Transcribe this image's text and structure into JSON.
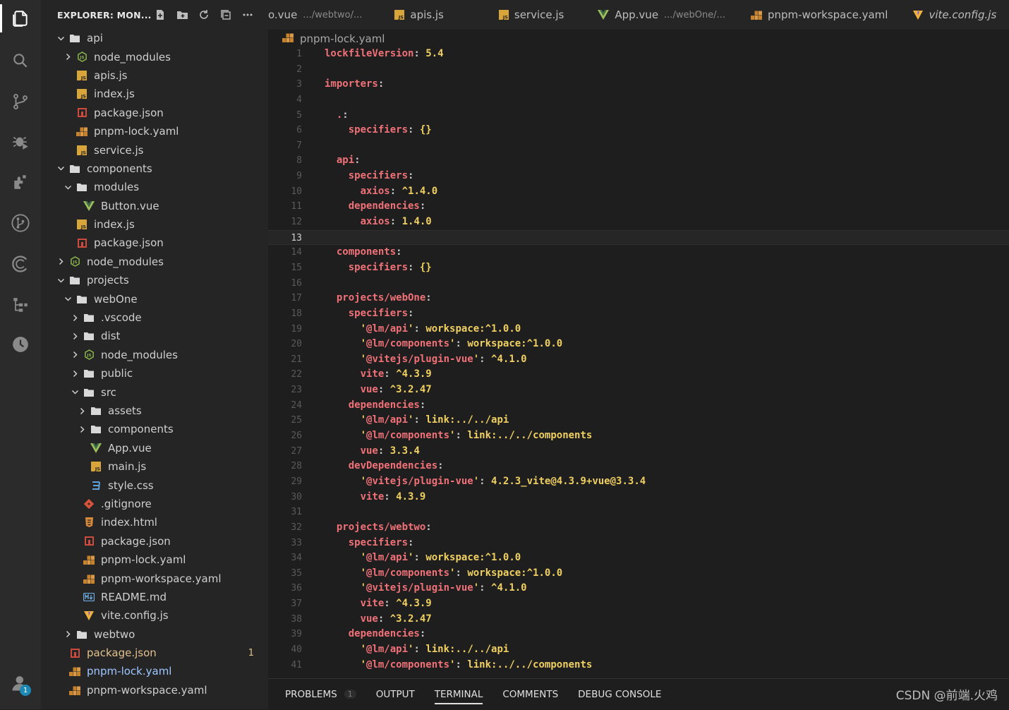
{
  "activity": {
    "items": [
      "files-icon",
      "search-icon",
      "source-control-icon",
      "debug-icon",
      "extensions-icon",
      "git-graph-icon",
      "copilot-icon",
      "timeline-icon",
      "clock-icon"
    ],
    "account_badge": "1"
  },
  "explorer": {
    "title": "EXPLORER: MON...",
    "rows": [
      {
        "depth": 0,
        "chev": "open",
        "icon": "folder",
        "label": "api"
      },
      {
        "depth": 1,
        "chev": "closed",
        "icon": "node",
        "label": "node_modules"
      },
      {
        "depth": 1,
        "chev": "none",
        "icon": "js",
        "label": "apis.js"
      },
      {
        "depth": 1,
        "chev": "none",
        "icon": "js",
        "label": "index.js"
      },
      {
        "depth": 1,
        "chev": "none",
        "icon": "pkg",
        "label": "package.json"
      },
      {
        "depth": 1,
        "chev": "none",
        "icon": "yaml",
        "label": "pnpm-lock.yaml"
      },
      {
        "depth": 1,
        "chev": "none",
        "icon": "js",
        "label": "service.js"
      },
      {
        "depth": 0,
        "chev": "open",
        "icon": "folder",
        "label": "components"
      },
      {
        "depth": 1,
        "chev": "open",
        "icon": "folder",
        "label": "modules"
      },
      {
        "depth": 2,
        "chev": "none",
        "icon": "vue",
        "label": "Button.vue"
      },
      {
        "depth": 1,
        "chev": "none",
        "icon": "js",
        "label": "index.js"
      },
      {
        "depth": 1,
        "chev": "none",
        "icon": "pkg",
        "label": "package.json"
      },
      {
        "depth": 0,
        "chev": "closed",
        "icon": "node",
        "label": "node_modules"
      },
      {
        "depth": 0,
        "chev": "open",
        "icon": "folder",
        "label": "projects"
      },
      {
        "depth": 1,
        "chev": "open",
        "icon": "folder",
        "label": "webOne"
      },
      {
        "depth": 2,
        "chev": "closed",
        "icon": "folder",
        "label": ".vscode"
      },
      {
        "depth": 2,
        "chev": "closed",
        "icon": "folder",
        "label": "dist"
      },
      {
        "depth": 2,
        "chev": "closed",
        "icon": "node",
        "label": "node_modules"
      },
      {
        "depth": 2,
        "chev": "closed",
        "icon": "folder",
        "label": "public"
      },
      {
        "depth": 2,
        "chev": "open",
        "icon": "folder",
        "label": "src"
      },
      {
        "depth": 3,
        "chev": "closed",
        "icon": "folder",
        "label": "assets"
      },
      {
        "depth": 3,
        "chev": "closed",
        "icon": "folder",
        "label": "components"
      },
      {
        "depth": 3,
        "chev": "none",
        "icon": "vue",
        "label": "App.vue"
      },
      {
        "depth": 3,
        "chev": "none",
        "icon": "js",
        "label": "main.js"
      },
      {
        "depth": 3,
        "chev": "none",
        "icon": "css",
        "label": "style.css"
      },
      {
        "depth": 2,
        "chev": "none",
        "icon": "git",
        "label": ".gitignore"
      },
      {
        "depth": 2,
        "chev": "none",
        "icon": "html",
        "label": "index.html"
      },
      {
        "depth": 2,
        "chev": "none",
        "icon": "pkg",
        "label": "package.json"
      },
      {
        "depth": 2,
        "chev": "none",
        "icon": "yaml",
        "label": "pnpm-lock.yaml"
      },
      {
        "depth": 2,
        "chev": "none",
        "icon": "yaml",
        "label": "pnpm-workspace.yaml"
      },
      {
        "depth": 2,
        "chev": "none",
        "icon": "md",
        "label": "README.md"
      },
      {
        "depth": 2,
        "chev": "none",
        "icon": "vite",
        "label": "vite.config.js"
      },
      {
        "depth": 1,
        "chev": "closed",
        "icon": "folder",
        "label": "webtwo"
      },
      {
        "depth": 0,
        "chev": "none",
        "icon": "pkg",
        "label": "package.json",
        "state": "modified",
        "count": "1"
      },
      {
        "depth": 0,
        "chev": "none",
        "icon": "yaml",
        "label": "pnpm-lock.yaml",
        "state": "active"
      },
      {
        "depth": 0,
        "chev": "none",
        "icon": "yaml",
        "label": "pnpm-workspace.yaml"
      }
    ]
  },
  "tabs": [
    {
      "name": "o.vue",
      "path": ".../webtwo/...",
      "icon": "none",
      "italic": false
    },
    {
      "name": "apis.js",
      "path": "",
      "icon": "js",
      "italic": false
    },
    {
      "name": "service.js",
      "path": "",
      "icon": "js",
      "italic": false
    },
    {
      "name": "App.vue",
      "path": ".../webOne/...",
      "icon": "vue",
      "italic": false
    },
    {
      "name": "pnpm-workspace.yaml",
      "path": "",
      "icon": "yaml",
      "italic": false
    },
    {
      "name": "vite.config.js",
      "path": "",
      "icon": "vite",
      "italic": true
    }
  ],
  "breadcrumb": "pnpm-lock.yaml",
  "editor": {
    "current_line": 13,
    "lines": [
      [
        [
          "k",
          "lockfileVersion"
        ],
        [
          "p",
          ": "
        ],
        [
          "v",
          "5.4"
        ]
      ],
      [],
      [
        [
          "k",
          "importers"
        ],
        [
          "p",
          ":"
        ]
      ],
      [],
      [
        [
          "p",
          "  "
        ],
        [
          "k",
          "."
        ],
        [
          "p",
          ":"
        ]
      ],
      [
        [
          "p",
          "    "
        ],
        [
          "k",
          "specifiers"
        ],
        [
          "p",
          ": "
        ],
        [
          "v",
          "{}"
        ]
      ],
      [],
      [
        [
          "p",
          "  "
        ],
        [
          "k",
          "api"
        ],
        [
          "p",
          ":"
        ]
      ],
      [
        [
          "p",
          "    "
        ],
        [
          "k",
          "specifiers"
        ],
        [
          "p",
          ":"
        ]
      ],
      [
        [
          "p",
          "      "
        ],
        [
          "k",
          "axios"
        ],
        [
          "p",
          ": "
        ],
        [
          "v",
          "^1.4.0"
        ]
      ],
      [
        [
          "p",
          "    "
        ],
        [
          "k",
          "dependencies"
        ],
        [
          "p",
          ":"
        ]
      ],
      [
        [
          "p",
          "      "
        ],
        [
          "k",
          "axios"
        ],
        [
          "p",
          ": "
        ],
        [
          "v",
          "1.4.0"
        ]
      ],
      [],
      [
        [
          "p",
          "  "
        ],
        [
          "k",
          "components"
        ],
        [
          "p",
          ":"
        ]
      ],
      [
        [
          "p",
          "    "
        ],
        [
          "k",
          "specifiers"
        ],
        [
          "p",
          ": "
        ],
        [
          "v",
          "{}"
        ]
      ],
      [],
      [
        [
          "p",
          "  "
        ],
        [
          "k",
          "projects/webOne"
        ],
        [
          "p",
          ":"
        ]
      ],
      [
        [
          "p",
          "    "
        ],
        [
          "k",
          "specifiers"
        ],
        [
          "p",
          ":"
        ]
      ],
      [
        [
          "p",
          "      "
        ],
        [
          "s",
          "'"
        ],
        [
          "k",
          "@lm/api"
        ],
        [
          "s",
          "'"
        ],
        [
          "p",
          ": "
        ],
        [
          "v",
          "workspace:^1.0.0"
        ]
      ],
      [
        [
          "p",
          "      "
        ],
        [
          "s",
          "'"
        ],
        [
          "k",
          "@lm/components"
        ],
        [
          "s",
          "'"
        ],
        [
          "p",
          ": "
        ],
        [
          "v",
          "workspace:^1.0.0"
        ]
      ],
      [
        [
          "p",
          "      "
        ],
        [
          "s",
          "'"
        ],
        [
          "k",
          "@vitejs/plugin-vue"
        ],
        [
          "s",
          "'"
        ],
        [
          "p",
          ": "
        ],
        [
          "v",
          "^4.1.0"
        ]
      ],
      [
        [
          "p",
          "      "
        ],
        [
          "k",
          "vite"
        ],
        [
          "p",
          ": "
        ],
        [
          "v",
          "^4.3.9"
        ]
      ],
      [
        [
          "p",
          "      "
        ],
        [
          "k",
          "vue"
        ],
        [
          "p",
          ": "
        ],
        [
          "v",
          "^3.2.47"
        ]
      ],
      [
        [
          "p",
          "    "
        ],
        [
          "k",
          "dependencies"
        ],
        [
          "p",
          ":"
        ]
      ],
      [
        [
          "p",
          "      "
        ],
        [
          "s",
          "'"
        ],
        [
          "k",
          "@lm/api"
        ],
        [
          "s",
          "'"
        ],
        [
          "p",
          ": "
        ],
        [
          "v",
          "link:../../api"
        ]
      ],
      [
        [
          "p",
          "      "
        ],
        [
          "s",
          "'"
        ],
        [
          "k",
          "@lm/components"
        ],
        [
          "s",
          "'"
        ],
        [
          "p",
          ": "
        ],
        [
          "v",
          "link:../../components"
        ]
      ],
      [
        [
          "p",
          "      "
        ],
        [
          "k",
          "vue"
        ],
        [
          "p",
          ": "
        ],
        [
          "v",
          "3.3.4"
        ]
      ],
      [
        [
          "p",
          "    "
        ],
        [
          "k",
          "devDependencies"
        ],
        [
          "p",
          ":"
        ]
      ],
      [
        [
          "p",
          "      "
        ],
        [
          "s",
          "'"
        ],
        [
          "k",
          "@vitejs/plugin-vue"
        ],
        [
          "s",
          "'"
        ],
        [
          "p",
          ": "
        ],
        [
          "v",
          "4.2.3_vite@4.3.9+vue@3.3.4"
        ]
      ],
      [
        [
          "p",
          "      "
        ],
        [
          "k",
          "vite"
        ],
        [
          "p",
          ": "
        ],
        [
          "v",
          "4.3.9"
        ]
      ],
      [],
      [
        [
          "p",
          "  "
        ],
        [
          "k",
          "projects/webtwo"
        ],
        [
          "p",
          ":"
        ]
      ],
      [
        [
          "p",
          "    "
        ],
        [
          "k",
          "specifiers"
        ],
        [
          "p",
          ":"
        ]
      ],
      [
        [
          "p",
          "      "
        ],
        [
          "s",
          "'"
        ],
        [
          "k",
          "@lm/api"
        ],
        [
          "s",
          "'"
        ],
        [
          "p",
          ": "
        ],
        [
          "v",
          "workspace:^1.0.0"
        ]
      ],
      [
        [
          "p",
          "      "
        ],
        [
          "s",
          "'"
        ],
        [
          "k",
          "@lm/components"
        ],
        [
          "s",
          "'"
        ],
        [
          "p",
          ": "
        ],
        [
          "v",
          "workspace:^1.0.0"
        ]
      ],
      [
        [
          "p",
          "      "
        ],
        [
          "s",
          "'"
        ],
        [
          "k",
          "@vitejs/plugin-vue"
        ],
        [
          "s",
          "'"
        ],
        [
          "p",
          ": "
        ],
        [
          "v",
          "^4.1.0"
        ]
      ],
      [
        [
          "p",
          "      "
        ],
        [
          "k",
          "vite"
        ],
        [
          "p",
          ": "
        ],
        [
          "v",
          "^4.3.9"
        ]
      ],
      [
        [
          "p",
          "      "
        ],
        [
          "k",
          "vue"
        ],
        [
          "p",
          ": "
        ],
        [
          "v",
          "^3.2.47"
        ]
      ],
      [
        [
          "p",
          "    "
        ],
        [
          "k",
          "dependencies"
        ],
        [
          "p",
          ":"
        ]
      ],
      [
        [
          "p",
          "      "
        ],
        [
          "s",
          "'"
        ],
        [
          "k",
          "@lm/api"
        ],
        [
          "s",
          "'"
        ],
        [
          "p",
          ": "
        ],
        [
          "v",
          "link:../../api"
        ]
      ],
      [
        [
          "p",
          "      "
        ],
        [
          "s",
          "'"
        ],
        [
          "k",
          "@lm/components"
        ],
        [
          "s",
          "'"
        ],
        [
          "p",
          ": "
        ],
        [
          "v",
          "link:../../components"
        ]
      ]
    ]
  },
  "panel": {
    "tabs": [
      {
        "label": "PROBLEMS",
        "count": "1"
      },
      {
        "label": "OUTPUT"
      },
      {
        "label": "TERMINAL",
        "active": true
      },
      {
        "label": "COMMENTS"
      },
      {
        "label": "DEBUG CONSOLE"
      }
    ]
  },
  "watermark": "CSDN @前端.火鸡",
  "colors": {
    "key": "#f07178",
    "value": "#f0d060",
    "modified": "#e2c08d",
    "accent": "#1e88b5"
  }
}
